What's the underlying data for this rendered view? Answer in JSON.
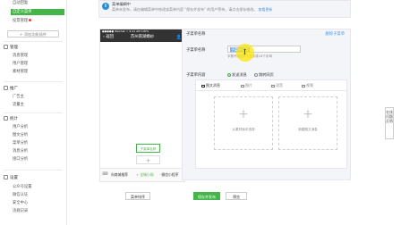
{
  "sidebar": {
    "top_items": [
      {
        "label": "自动回复"
      },
      {
        "label": "自定义菜单"
      },
      {
        "label": "投票管理"
      }
    ],
    "add_plugin": "+ 添加功能插件",
    "sections": [
      {
        "title": "管理",
        "items": [
          "消息管理",
          "用户管理",
          "素材管理"
        ]
      },
      {
        "title": "推广",
        "items": [
          "广告主",
          "流量主"
        ]
      },
      {
        "title": "统计",
        "items": [
          "用户分析",
          "图文分析",
          "菜单分析",
          "消息分析",
          "接口分析"
        ]
      },
      {
        "title": "设置",
        "items": [
          "公众号设置",
          "微信认证",
          "安全中心",
          "违规记录"
        ]
      }
    ]
  },
  "tip": {
    "title": "菜单编辑中",
    "text": "菜单未发布，请在编辑菜单中修改该菜单内容 \"保存并发布\" 的用户等待，请点击保存修改。",
    "link": "查看更新"
  },
  "phone": {
    "status": "●●●●● WeChat ⌔   9:41 AM   100%",
    "title": "苏州南湖婚纱",
    "back": "‹ 返回",
    "sub_menu_name": "子菜单名称",
    "plus": "+",
    "keyboard_icon": "⌨",
    "menus": [
      "向商城推荐",
      "+ 全城小场",
      "· 微信小程序"
    ]
  },
  "editor": {
    "header": "子菜单名称",
    "delete_link": "删除子菜单",
    "name_label": "子菜单名称",
    "name_value": "子菜单名称",
    "hint": "字数不超过8个汉字或16个字母",
    "content_label": "子菜单内容",
    "radio_options": [
      {
        "label": "发送消息",
        "checked": true
      },
      {
        "label": "跳转网页",
        "checked": false
      }
    ],
    "tabs": [
      "图文消息",
      "图片",
      "语音",
      "视频"
    ],
    "cards": [
      {
        "plus": "+",
        "label": "从素材库中选择"
      },
      {
        "plus": "+",
        "label": "新建图文消息"
      }
    ]
  },
  "buttons": {
    "sort": "菜单排序",
    "save_publish": "保存并发布",
    "preview": "预览"
  },
  "floating": {
    "label": "在线问题反馈"
  },
  "colors": {
    "accent": "#44b549",
    "link": "#459ae9",
    "info": "#2d8cd8"
  }
}
